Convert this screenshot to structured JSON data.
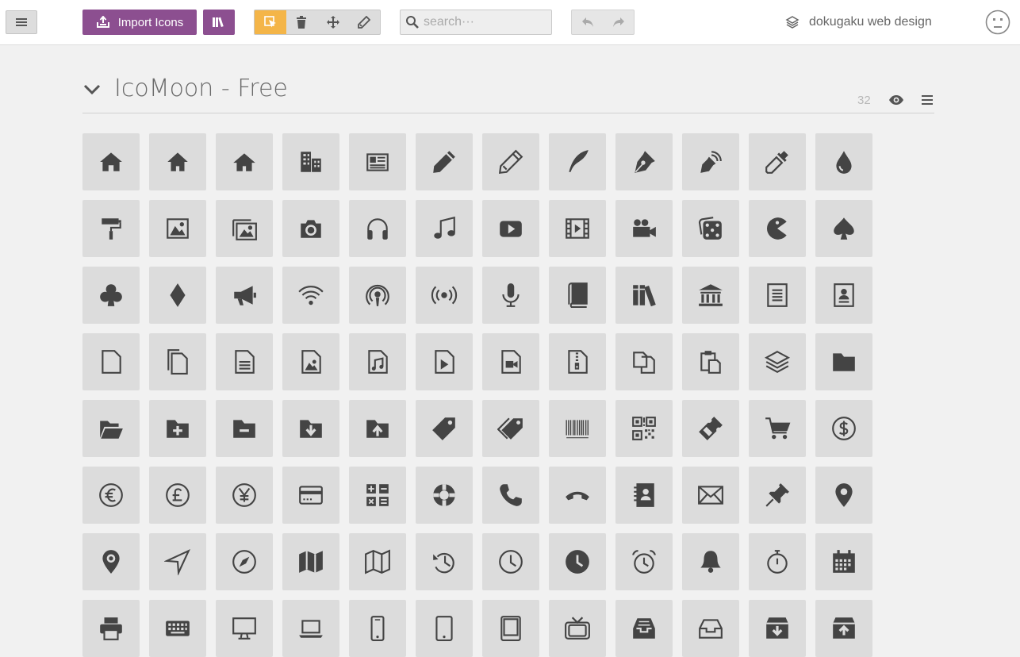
{
  "toolbar": {
    "import_label": "Import Icons",
    "search_placeholder": "search···",
    "project_name": "dokugaku web design"
  },
  "set": {
    "title": "IcoMoon - Free",
    "count": "32"
  },
  "colors": {
    "accent_purple": "#8c4f90",
    "active_tool": "#f4b548",
    "icon": "#444444",
    "cell_bg": "#dcdcdc"
  },
  "icons": [
    "home",
    "home2",
    "home3",
    "office",
    "newspaper",
    "pencil",
    "pencil2",
    "quill",
    "pen",
    "blog",
    "eyedropper",
    "droplet",
    "paint-format",
    "image",
    "images",
    "camera",
    "headphones",
    "music",
    "play",
    "film",
    "video-camera",
    "dice",
    "pacman",
    "spades",
    "clubs",
    "diamonds",
    "bullhorn",
    "connection",
    "podcast",
    "feed",
    "mic",
    "book",
    "books",
    "library",
    "file-text",
    "profile",
    "file-empty",
    "files-empty",
    "file-text2",
    "file-picture",
    "file-music",
    "file-play",
    "file-video",
    "file-zip",
    "copy",
    "paste",
    "stack",
    "folder",
    "folder-open",
    "folder-plus",
    "folder-minus",
    "folder-download",
    "folder-upload",
    "price-tag",
    "price-tags",
    "barcode",
    "qrcode",
    "ticket",
    "cart",
    "coin-dollar",
    "coin-euro",
    "coin-pound",
    "coin-yen",
    "credit-card",
    "calculator",
    "lifebuoy",
    "phone",
    "phone-hang-up",
    "address-book",
    "envelop",
    "pushpin",
    "location",
    "location2",
    "compass",
    "compass2",
    "map",
    "map2",
    "history",
    "clock",
    "clock2",
    "alarm",
    "bell",
    "stopwatch",
    "calendar",
    "printer",
    "keyboard",
    "display",
    "laptop",
    "mobile",
    "mobile2",
    "tablet",
    "tv",
    "drawer",
    "drawer2",
    "box-add",
    "box-remove"
  ]
}
